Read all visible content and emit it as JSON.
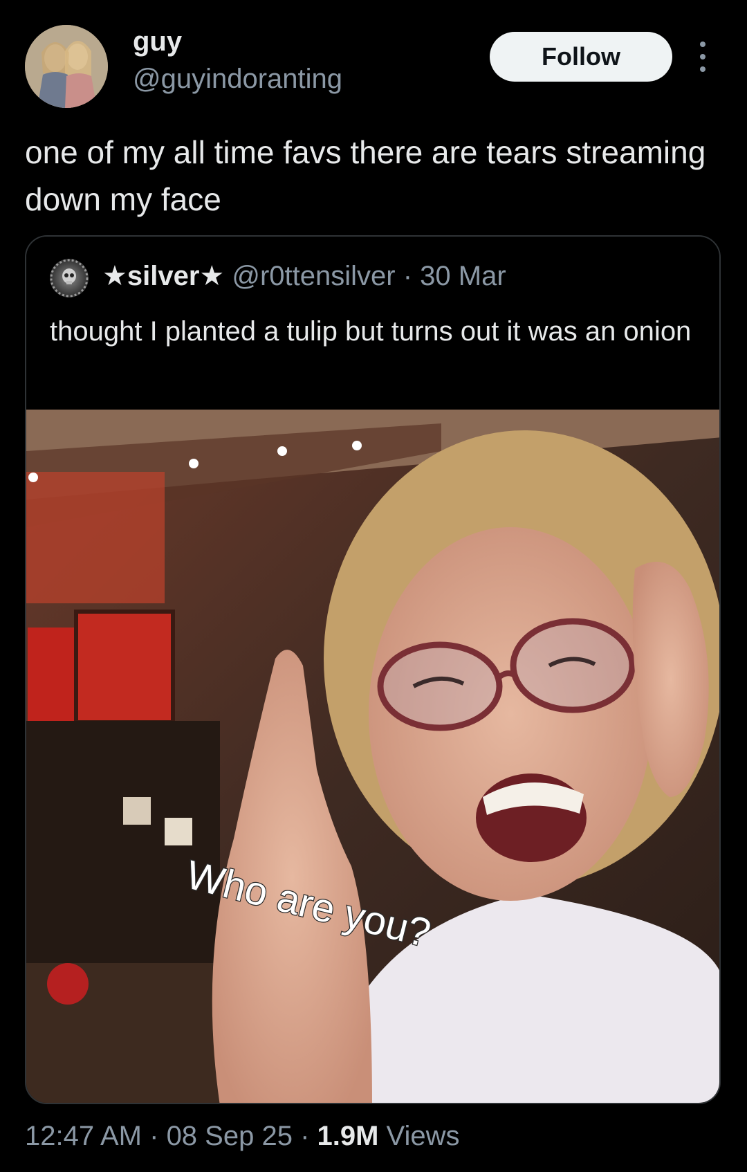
{
  "post": {
    "display_name": "guy",
    "handle": "@guyindoranting",
    "follow_label": "Follow",
    "text": "one of my all time favs there are tears streaming down my face"
  },
  "quote": {
    "display_name": "★silver★",
    "handle": "@r0ttensilver",
    "separator": " · ",
    "date": "30 Mar",
    "text": "thought I planted a tulip but turns out it was an onion",
    "media_caption": "Who are you?"
  },
  "footer": {
    "time": "12:47 AM",
    "sep1": " · ",
    "date": "08 Sep 25",
    "sep2": " · ",
    "views_count": "1.9M",
    "views_label": " Views"
  },
  "icons": {
    "more": "more-options-icon"
  },
  "colors": {
    "background": "#000000",
    "text_primary": "#e7e9ea",
    "text_secondary": "#8b98a5",
    "follow_bg": "#eff3f4",
    "border": "#2f3336"
  }
}
